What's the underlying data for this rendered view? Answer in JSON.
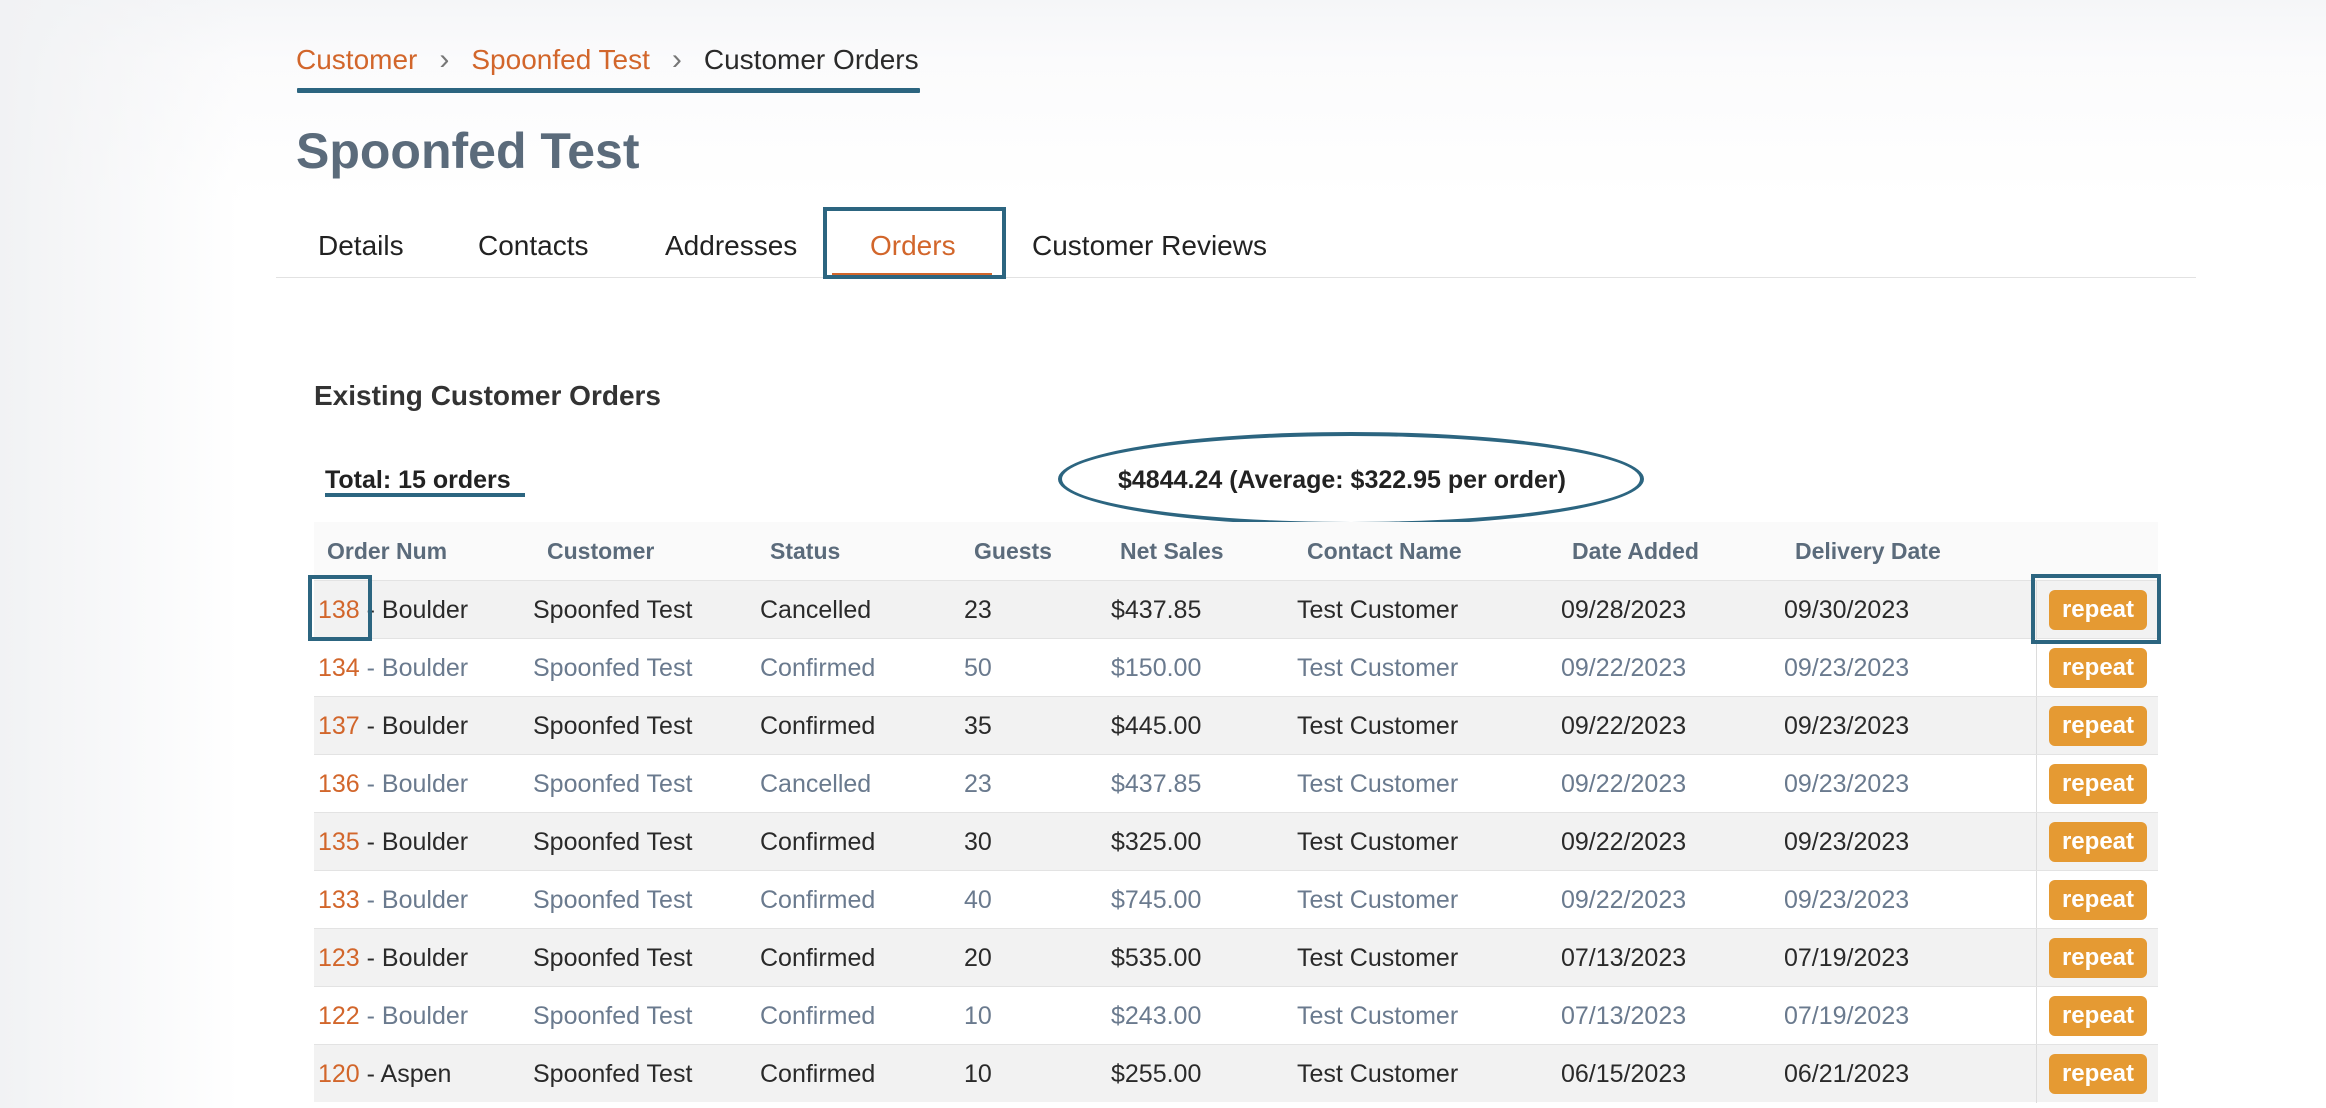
{
  "breadcrumb": {
    "items": [
      "Customer",
      "Spoonfed Test"
    ],
    "current": "Customer Orders",
    "separator": "›"
  },
  "page": {
    "title": "Spoonfed Test"
  },
  "tabs": [
    {
      "label": "Details"
    },
    {
      "label": "Contacts"
    },
    {
      "label": "Addresses"
    },
    {
      "label": "Orders",
      "active": true
    },
    {
      "label": "Customer Reviews"
    }
  ],
  "orders_section": {
    "title": "Existing Customer Orders",
    "total": "Total: 15 orders",
    "summary": "$4844.24 (Average: $322.95 per order)"
  },
  "table": {
    "headers": [
      "Order Num",
      "Customer",
      "Status",
      "Guests",
      "Net Sales",
      "Contact Name",
      "Date Added",
      "Delivery Date"
    ],
    "rows": [
      {
        "num": "138",
        "location": " - Boulder",
        "customer": "Spoonfed Test",
        "status": "Cancelled",
        "guests": "23",
        "net_sales": "$437.85",
        "contact": "Test Customer",
        "date_added": "09/28/2023",
        "delivery": "09/30/2023",
        "action": "repeat"
      },
      {
        "num": "134",
        "location": " - Boulder",
        "customer": "Spoonfed Test",
        "status": "Confirmed",
        "guests": "50",
        "net_sales": "$150.00",
        "contact": "Test Customer",
        "date_added": "09/22/2023",
        "delivery": "09/23/2023",
        "action": "repeat"
      },
      {
        "num": "137",
        "location": " - Boulder",
        "customer": "Spoonfed Test",
        "status": "Confirmed",
        "guests": "35",
        "net_sales": "$445.00",
        "contact": "Test Customer",
        "date_added": "09/22/2023",
        "delivery": "09/23/2023",
        "action": "repeat"
      },
      {
        "num": "136",
        "location": " - Boulder",
        "customer": "Spoonfed Test",
        "status": "Cancelled",
        "guests": "23",
        "net_sales": "$437.85",
        "contact": "Test Customer",
        "date_added": "09/22/2023",
        "delivery": "09/23/2023",
        "action": "repeat"
      },
      {
        "num": "135",
        "location": " - Boulder",
        "customer": "Spoonfed Test",
        "status": "Confirmed",
        "guests": "30",
        "net_sales": "$325.00",
        "contact": "Test Customer",
        "date_added": "09/22/2023",
        "delivery": "09/23/2023",
        "action": "repeat"
      },
      {
        "num": "133",
        "location": " - Boulder",
        "customer": "Spoonfed Test",
        "status": "Confirmed",
        "guests": "40",
        "net_sales": "$745.00",
        "contact": "Test Customer",
        "date_added": "09/22/2023",
        "delivery": "09/23/2023",
        "action": "repeat"
      },
      {
        "num": "123",
        "location": " - Boulder",
        "customer": "Spoonfed Test",
        "status": "Confirmed",
        "guests": "20",
        "net_sales": "$535.00",
        "contact": "Test Customer",
        "date_added": "07/13/2023",
        "delivery": "07/19/2023",
        "action": "repeat"
      },
      {
        "num": "122",
        "location": " - Boulder",
        "customer": "Spoonfed Test",
        "status": "Confirmed",
        "guests": "10",
        "net_sales": "$243.00",
        "contact": "Test Customer",
        "date_added": "07/13/2023",
        "delivery": "07/19/2023",
        "action": "repeat"
      },
      {
        "num": "120",
        "location": " - Aspen",
        "customer": "Spoonfed Test",
        "status": "Confirmed",
        "guests": "10",
        "net_sales": "$255.00",
        "contact": "Test Customer",
        "date_added": "06/15/2023",
        "delivery": "06/21/2023",
        "action": "repeat"
      }
    ]
  },
  "colors": {
    "accent": "#d2662b",
    "highlight_outline": "#2c6580",
    "repeat_button": "#e59a33",
    "title_gray": "#5b6b7b"
  }
}
